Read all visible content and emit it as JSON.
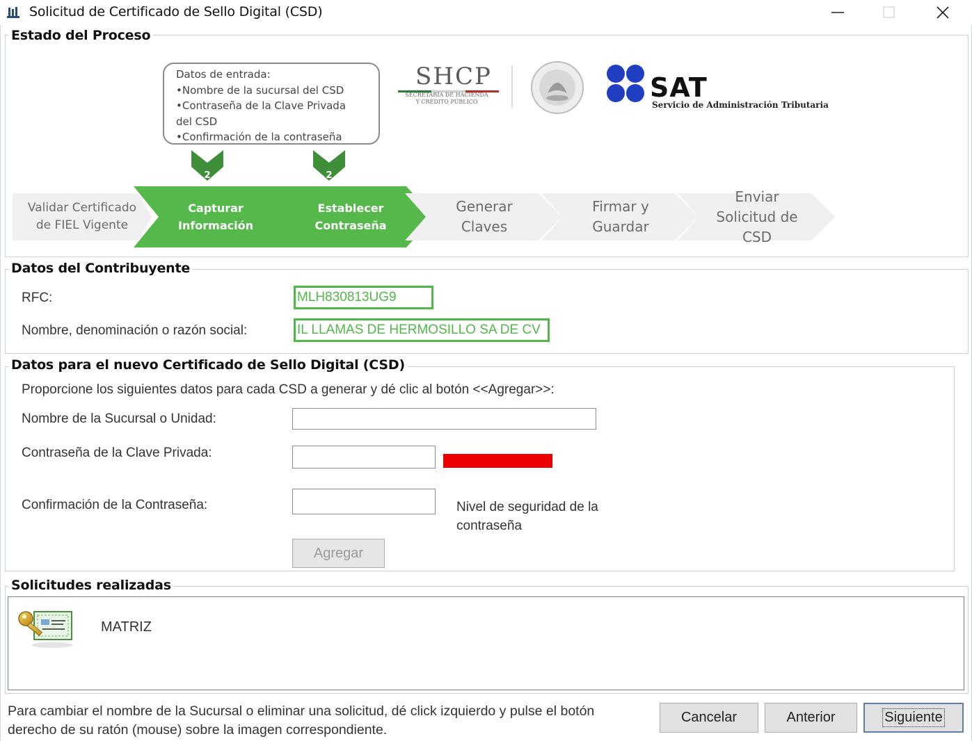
{
  "window": {
    "title": "Solicitud de Certificado de Sello Digital (CSD)",
    "minimize": "—",
    "maximize": "☐",
    "close": "✕"
  },
  "proceso": {
    "title": "Estado del Proceso",
    "callout": [
      "Datos de entrada:",
      "•Nombre de la sucursal del CSD",
      "•Contraseña de la Clave Privada",
      "del CSD",
      "•Confirmación de la contraseña"
    ],
    "arrow_badges": [
      "2",
      "2"
    ],
    "steps": [
      {
        "line1": "Validar Certificado",
        "line2": "de FIEL Vigente",
        "line3": "",
        "state": "done"
      },
      {
        "line1": "Capturar",
        "line2": "Información",
        "line3": "",
        "state": "active"
      },
      {
        "line1": "Establecer",
        "line2": "Contraseña",
        "line3": "",
        "state": "active"
      },
      {
        "line1": "Generar",
        "line2": "Claves",
        "line3": "",
        "state": "pending"
      },
      {
        "line1": "Firmar y",
        "line2": "Guardar",
        "line3": "",
        "state": "pending"
      },
      {
        "line1": "Enviar",
        "line2": "Solicitud de",
        "line3": "CSD",
        "state": "pending"
      }
    ],
    "logos": {
      "shcp": "SHCP",
      "shcp_sub1": "SECRETARÍA DE HACIENDA",
      "shcp_sub2": "Y CRÉDITO PÚBLICO",
      "sat": "SAT",
      "sat_sub": "Servicio de Administración Tributaria"
    },
    "colors": {
      "active": "#55b84a",
      "pending": "#f0f0f0"
    }
  },
  "contribuyente": {
    "title": "Datos del Contribuyente",
    "rfc_label": "RFC:",
    "rfc_value": "MLH830813UG9",
    "nombre_label": "Nombre, denominación o razón social:",
    "nombre_value": "IL LLAMAS DE HERMOSILLO SA DE CV"
  },
  "nuevo": {
    "title": "Datos para el nuevo Certificado de Sello Digital (CSD)",
    "instructions": "Proporcione los siguientes datos para cada CSD a generar y dé clic al botón <<Agregar>>:",
    "sucursal_label": "Nombre de la Sucursal o Unidad:",
    "sucursal_value": "",
    "password_label": "Contraseña de la Clave Privada:",
    "password_value": "",
    "confirm_label": "Confirmación de la Contraseña:",
    "confirm_value": "",
    "nivel_line1": "Nivel de seguridad de la",
    "nivel_line2": "contraseña",
    "strength_color": "#ee0000",
    "agregar_label": "Agregar"
  },
  "solicitudes": {
    "title": "Solicitudes realizadas",
    "items": [
      {
        "name": "MATRIZ",
        "icon": "certificate-key-icon"
      }
    ]
  },
  "footer": {
    "hint_line1": "Para cambiar el nombre de la Sucursal o eliminar una solicitud, dé click izquierdo y pulse el botón",
    "hint_line2": "derecho de su ratón (mouse) sobre la imagen correspondiente.",
    "cancelar": "Cancelar",
    "anterior": "Anterior",
    "siguiente": "Siguiente"
  }
}
